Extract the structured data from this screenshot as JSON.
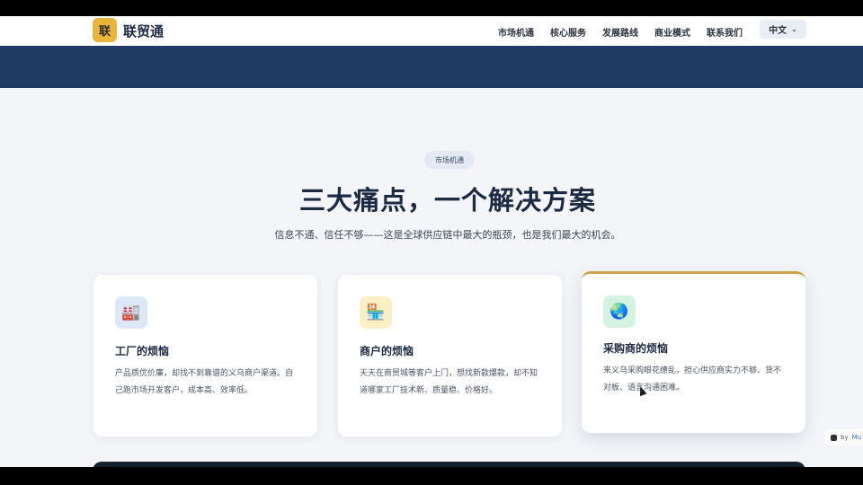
{
  "nav": {
    "logo_char": "联",
    "brand": "联贸通",
    "items": [
      "市场机通",
      "核心服务",
      "发展路线",
      "商业模式",
      "联系我们"
    ],
    "language": "中文"
  },
  "hero": {
    "tag": "市场机通",
    "heading": "三大痛点，一个解决方案",
    "subtext": "信息不通、信任不够——这是全球供应链中最大的瓶颈，也是我们最大的机会。"
  },
  "cards": [
    {
      "icon": "factory-icon",
      "icon_glyph": "🏭",
      "icon_bg": "#dce8f7",
      "title": "工厂的烦恼",
      "desc": "产品质优价廉，却找不到靠谱的义乌商户渠道。自己跑市场开发客户，成本高、效率低。"
    },
    {
      "icon": "shop-icon",
      "icon_glyph": "🏪",
      "icon_bg": "#fbefc3",
      "title": "商户的烦恼",
      "desc": "天天在商贸城等客户上门，想找新款爆款，却不知道哪家工厂技术新、质量稳、价格好。"
    },
    {
      "icon": "globe-icon",
      "icon_glyph": "🌏",
      "icon_bg": "#d5f3e1",
      "title": "采购商的烦恼",
      "desc": "来义乌采购眼花缭乱，担心供应商实力不够、货不对板、语言沟通困难。"
    }
  ],
  "badge": {
    "by": "by",
    "brand": "Mu"
  },
  "colors": {
    "navy": "#1f3a63",
    "gold": "#e9b53a",
    "accent_border": "#c9a44b"
  }
}
